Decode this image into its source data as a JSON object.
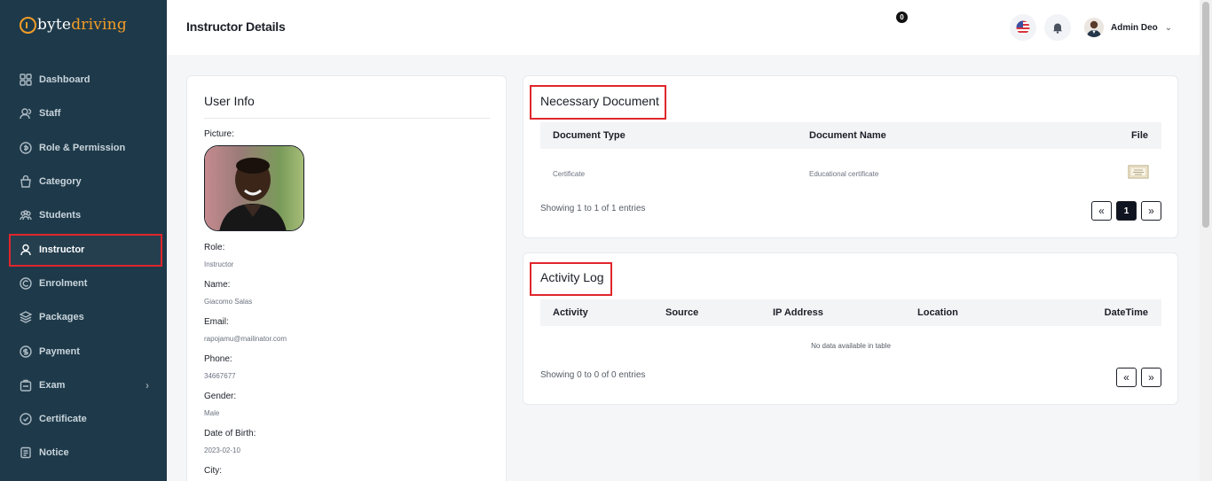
{
  "brand": {
    "part1": "byte",
    "part2": "driving"
  },
  "sidebar": {
    "items": [
      {
        "label": "Dashboard",
        "icon": "dashboard-icon"
      },
      {
        "label": "Staff",
        "icon": "staff-icon"
      },
      {
        "label": "Role & Permission",
        "icon": "permission-icon"
      },
      {
        "label": "Category",
        "icon": "category-icon"
      },
      {
        "label": "Students",
        "icon": "students-icon"
      },
      {
        "label": "Instructor",
        "icon": "instructor-icon",
        "active": true
      },
      {
        "label": "Enrolment",
        "icon": "enrolment-icon"
      },
      {
        "label": "Packages",
        "icon": "packages-icon"
      },
      {
        "label": "Payment",
        "icon": "payment-icon"
      },
      {
        "label": "Exam",
        "icon": "exam-icon",
        "has_submenu": true
      },
      {
        "label": "Certificate",
        "icon": "certificate-icon"
      },
      {
        "label": "Notice",
        "icon": "notice-icon"
      }
    ]
  },
  "header": {
    "title": "Instructor Details",
    "notification_count": "0",
    "user_name": "Admin Deo"
  },
  "user_info": {
    "title": "User Info",
    "picture_label": "Picture:",
    "fields": [
      {
        "label": "Role:",
        "value": "Instructor"
      },
      {
        "label": "Name:",
        "value": "Giacomo Salas"
      },
      {
        "label": "Email:",
        "value": "rapojamu@mailinator.com"
      },
      {
        "label": "Phone:",
        "value": "34667677"
      },
      {
        "label": "Gender:",
        "value": "Male"
      },
      {
        "label": "Date of Birth:",
        "value": "2023-02-10"
      },
      {
        "label": "City:",
        "value": ""
      }
    ]
  },
  "documents": {
    "title": "Necessary Document",
    "columns": [
      "Document Type",
      "Document Name",
      "File"
    ],
    "rows": [
      {
        "type": "Certificate",
        "name": "Educational certificate",
        "file_icon": "certificate-file-icon"
      }
    ],
    "showing": "Showing 1 to 1 of 1 entries",
    "pagination": {
      "prev": "«",
      "current": "1",
      "next": "»"
    }
  },
  "activity": {
    "title": "Activity Log",
    "columns": [
      "Activity",
      "Source",
      "IP Address",
      "Location",
      "DateTime"
    ],
    "empty_text": "No data available in table",
    "showing": "Showing 0 to 0 of 0 entries",
    "pagination": {
      "prev": "«",
      "next": "»"
    }
  },
  "colors": {
    "sidebar_bg": "#1e3a4a",
    "brand_orange": "#f39c25",
    "highlight_red": "#e0262c"
  }
}
